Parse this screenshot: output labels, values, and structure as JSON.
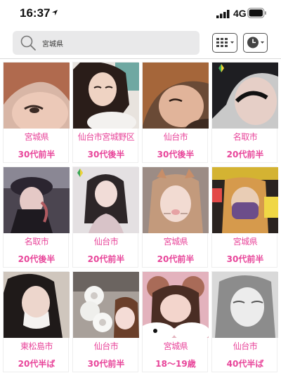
{
  "status": {
    "time": "16:37",
    "network": "4G"
  },
  "search": {
    "query": "宮城県"
  },
  "toolbar": {
    "grid_icon": "grid-menu-icon",
    "clock_icon": "clock-icon"
  },
  "colors": {
    "accent": "#e8459a",
    "search_bg": "#e9e9ea"
  },
  "profiles": [
    {
      "area": "宮城県",
      "age": "30代前半"
    },
    {
      "area": "仙台市宮城野区",
      "age": "30代後半"
    },
    {
      "area": "仙台市",
      "age": "30代後半"
    },
    {
      "area": "名取市",
      "age": "20代前半"
    },
    {
      "area": "名取市",
      "age": "20代後半"
    },
    {
      "area": "仙台市",
      "age": "20代前半"
    },
    {
      "area": "宮城県",
      "age": "20代前半"
    },
    {
      "area": "宮城県",
      "age": "30代前半"
    },
    {
      "area": "東松島市",
      "age": "20代半ば"
    },
    {
      "area": "仙台市",
      "age": "30代前半"
    },
    {
      "area": "宮城県",
      "age": "18〜19歳"
    },
    {
      "area": "仙台市",
      "age": "40代半ば"
    }
  ]
}
